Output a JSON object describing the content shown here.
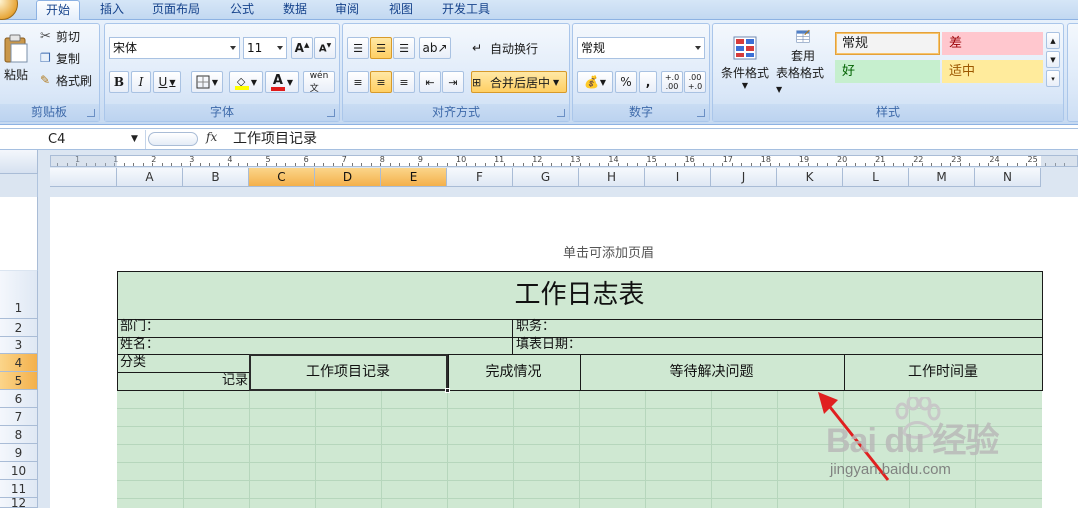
{
  "ribbon_tabs": [
    "开始",
    "插入",
    "页面布局",
    "公式",
    "数据",
    "审阅",
    "视图",
    "开发工具"
  ],
  "clipboard": {
    "paste": "粘贴",
    "cut": "剪切",
    "copy": "复制",
    "format_painter": "格式刷",
    "group": "剪贴板"
  },
  "font": {
    "name": "宋体",
    "size": "11",
    "bold": "B",
    "italic": "I",
    "underline": "U",
    "font_color_letter": "A",
    "group": "字体"
  },
  "alignment": {
    "wrap_text": "自动换行",
    "merge_center": "合并后居中",
    "group": "对齐方式"
  },
  "number": {
    "format": "常规",
    "percent": "%",
    "comma": ",",
    "inc_decimal": "+.0 .00",
    "dec_decimal": ".00 +.0",
    "group": "数字"
  },
  "styles": {
    "conditional_format": "条件格式",
    "table_format_1": "套用",
    "table_format_2": "表格格式",
    "normal": "常规",
    "bad": "差",
    "good": "好",
    "neutral": "适中",
    "group": "样式"
  },
  "formula_bar": {
    "cell_ref": "C4",
    "fx": "fx",
    "value": "工作项目记录"
  },
  "columns": [
    "A",
    "B",
    "C",
    "D",
    "E",
    "F",
    "G",
    "H",
    "I",
    "J",
    "K",
    "L",
    "M",
    "N"
  ],
  "selected_columns": [
    "C",
    "D",
    "E"
  ],
  "rows": [
    "1",
    "2",
    "3",
    "4",
    "5",
    "6",
    "7",
    "8",
    "9",
    "10",
    "11",
    "12"
  ],
  "selected_rows": [
    "4",
    "5"
  ],
  "ruler_marks": [
    "1",
    "1",
    "2",
    "3",
    "4",
    "5",
    "6",
    "7",
    "8",
    "9",
    "10",
    "11",
    "12",
    "13",
    "14",
    "15",
    "16",
    "17",
    "18",
    "19",
    "20",
    "21",
    "22",
    "23",
    "24",
    "25"
  ],
  "page": {
    "header_hint": "单击可添加页眉",
    "title": "工作日志表",
    "department": "部门：",
    "position": "职务：",
    "name": "姓名：",
    "fill_date": "填表日期：",
    "category": "分类",
    "record": "记录",
    "col_work_items": "工作项目记录",
    "col_completion": "完成情况",
    "col_pending": "等待解决问题",
    "col_hours": "工作时间量"
  },
  "watermark": {
    "brand": "Bai du 经验",
    "url": "jingyan.baidu.com"
  },
  "colors": {
    "sheet_fill": "#cfe8d2",
    "selection_header": "#f4b04b",
    "bad_style": "#ffc7ce",
    "good_style": "#c6efce",
    "neutral_style": "#ffeb9c",
    "arrow": "#e02020"
  }
}
